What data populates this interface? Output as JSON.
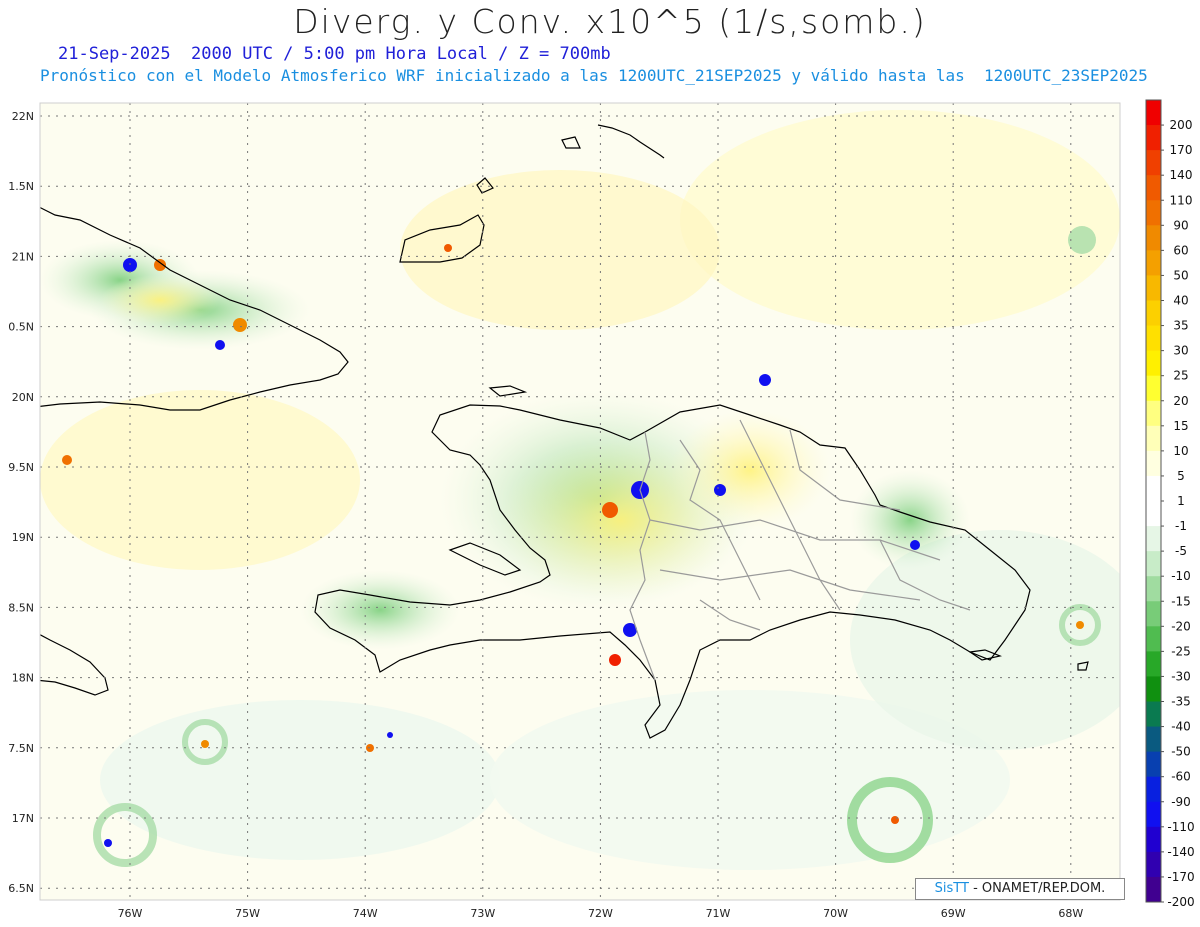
{
  "header": {
    "title": "Diverg. y Conv. x10^5 (1/s,somb.)",
    "subtitle_line1": "21-Sep-2025  2000 UTC / 5:00 pm Hora Local / Z = 700mb",
    "subtitle_line2": "Pronóstico con el Modelo Atmosferico WRF inicializado a las 1200UTC_21SEP2025 y válido hasta las  1200UTC_23SEP2025"
  },
  "credit": {
    "sis": "SisTT",
    "org": "- ONAMET/REP.DOM."
  },
  "axes": {
    "lat_labels": [
      "22N",
      "1.5N",
      "21N",
      "0.5N",
      "20N",
      "9.5N",
      "19N",
      "8.5N",
      "18N",
      "7.5N",
      "17N",
      "6.5N"
    ],
    "lon_labels": [
      "76W",
      "75W",
      "74W",
      "73W",
      "72W",
      "71W",
      "70W",
      "69W",
      "68W"
    ]
  },
  "colorbar": {
    "labels": [
      "200",
      "170",
      "140",
      "110",
      "90",
      "60",
      "50",
      "40",
      "35",
      "30",
      "25",
      "20",
      "15",
      "10",
      "5",
      "1",
      "-1",
      "-5",
      "-10",
      "-15",
      "-20",
      "-25",
      "-30",
      "-35",
      "-40",
      "-50",
      "-60",
      "-90",
      "-110",
      "-140",
      "-170",
      "-200"
    ],
    "colors": [
      "#f00000",
      "#f02000",
      "#f04000",
      "#f05a00",
      "#f07000",
      "#f08a00",
      "#f4a000",
      "#f8b800",
      "#fcd000",
      "#ffe000",
      "#fff000",
      "#ffff30",
      "#ffff80",
      "#ffffb8",
      "#ffffe0",
      "#ffffff",
      "#ffffff",
      "#e6f6e6",
      "#c8ecc8",
      "#a0dca0",
      "#78cc78",
      "#50bc50",
      "#28a828",
      "#109010",
      "#0a7a50",
      "#0a5a80",
      "#0840b0",
      "#0820e0",
      "#1010f0",
      "#2000d0",
      "#3000b0",
      "#400090"
    ]
  },
  "map_colors": {
    "coast": "#000000",
    "borders": "#9a9a9a",
    "grid": "#777777"
  }
}
